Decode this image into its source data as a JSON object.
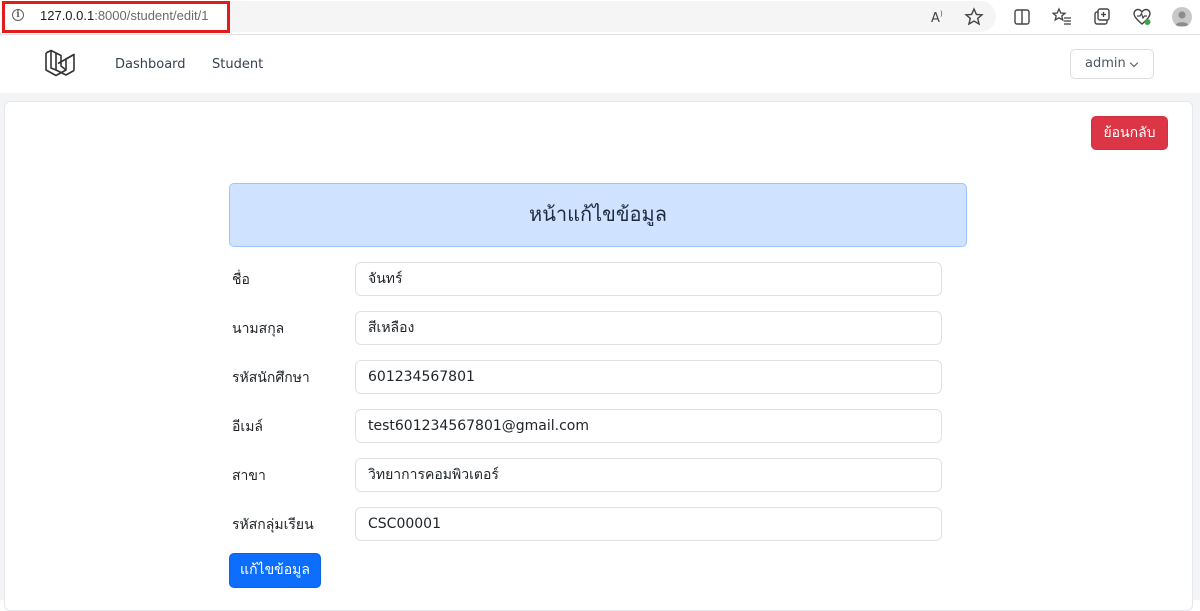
{
  "browser": {
    "url_host": "127.0.0.1",
    "url_rest": ":8000/student/edit/1"
  },
  "nav": {
    "links": [
      "Dashboard",
      "Student"
    ],
    "user": "admin"
  },
  "page": {
    "back_button": "ย้อนกลับ",
    "title": "หน้าแก้ไขข้อมูล",
    "fields": [
      {
        "label": "ชื่อ",
        "value": "จันทร์"
      },
      {
        "label": "นามสกุล",
        "value": "สีเหลือง"
      },
      {
        "label": "รหัสนักศึกษา",
        "value": "601234567801"
      },
      {
        "label": "อีเมล์",
        "value": "test601234567801@gmail.com"
      },
      {
        "label": "สาขา",
        "value": "วิทยาการคอมพิวเตอร์"
      },
      {
        "label": "รหัสกลุ่มเรียน",
        "value": "CSC00001"
      }
    ],
    "submit_button": "แก้ไขข้อมูล"
  },
  "colors": {
    "danger": "#dc3545",
    "primary": "#0d6efd",
    "title_bg": "#cfe2ff",
    "url_highlight": "#e21b1b"
  }
}
